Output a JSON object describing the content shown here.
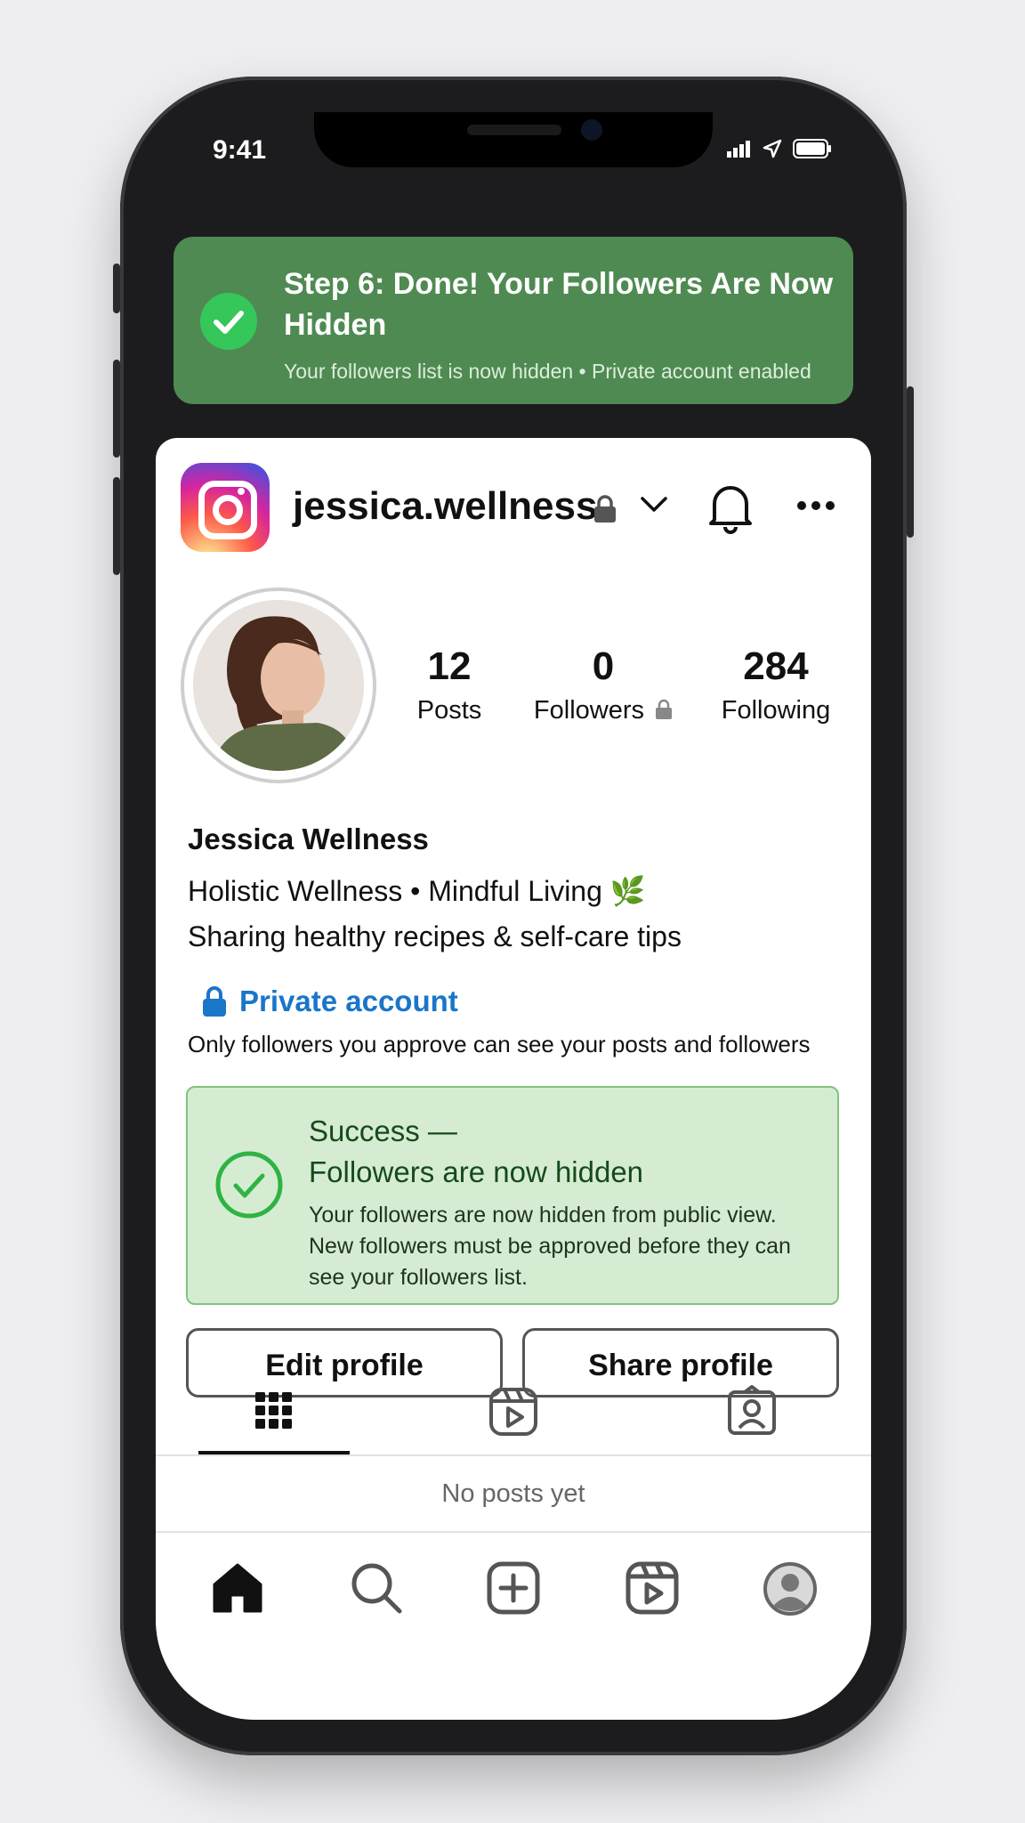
{
  "status_bar": {
    "time": "9:41",
    "icons": [
      "signal-icon",
      "location-arrow-icon",
      "battery-icon"
    ]
  },
  "banner": {
    "title": "Step 6: Done! Your Followers Are Now Hidden",
    "subtitle": "Your followers list is now hidden • Private account enabled",
    "color": "#4f8a52"
  },
  "profile_header": {
    "username": "jessica.wellness",
    "icons": [
      "instagram-logo",
      "lock-icon",
      "chevron-down-icon",
      "bell-icon",
      "more-icon"
    ]
  },
  "stats": [
    {
      "value": "12",
      "label": "Posts"
    },
    {
      "value": "0",
      "label": "Followers"
    },
    {
      "value": "284",
      "label": "Following"
    }
  ],
  "profile": {
    "full_name": "Jessica Wellness",
    "bio_line1": "Holistic Wellness • Mindful Living 🌿",
    "bio_line2": "Sharing healthy recipes & self-care tips"
  },
  "privacy": {
    "label": "Private account",
    "description": "Only followers you approve can see your posts and followers",
    "color": "#1976c9"
  },
  "success": {
    "title_line1": "Success —",
    "title_line2": "Followers are now hidden",
    "body": "Your followers are now hidden from public view. New followers must be approved before they can see your followers list.",
    "bg": "#d5ecd3"
  },
  "actions": {
    "edit": "Edit profile",
    "share": "Share profile"
  },
  "tabs": [
    "grid-icon",
    "reels-icon",
    "tagged-icon"
  ],
  "content": {
    "empty": "No posts yet"
  },
  "bottom_nav": [
    "home-icon",
    "search-icon",
    "create-icon",
    "reels-icon",
    "profile-icon"
  ]
}
